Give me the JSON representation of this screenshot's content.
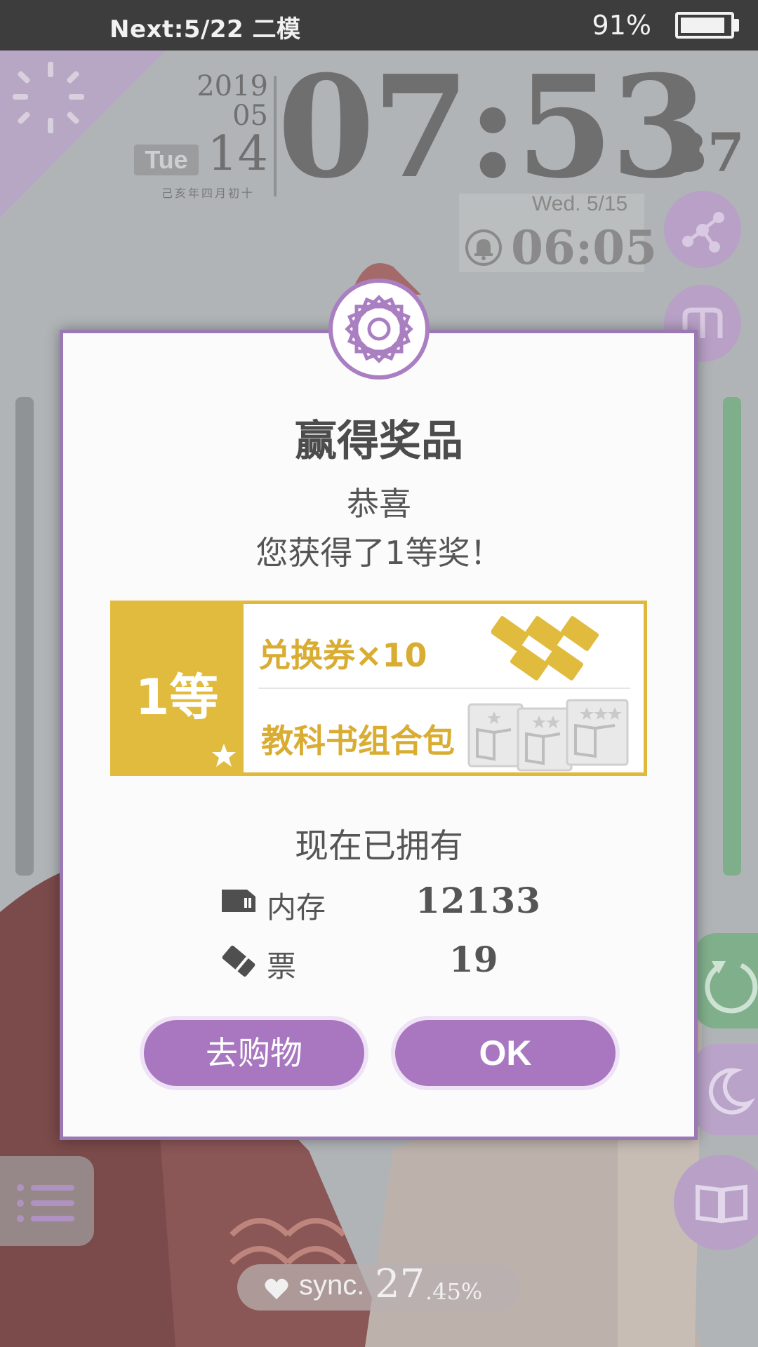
{
  "status_bar": {
    "left_text": "Next:5/22 二模",
    "battery_text": "91%",
    "battery_level": 0.91
  },
  "clock": {
    "year": "2019",
    "month": "05",
    "day": "14",
    "weekday": "Tue",
    "lunar_date": "己亥年四月初十",
    "time": "07:53",
    "seconds": "37"
  },
  "alarm": {
    "date": "Wed.  5/15",
    "time": "06:05"
  },
  "sync": {
    "label": "sync.",
    "value": "27",
    "percent": ".45%"
  },
  "dialog": {
    "title": "赢得奖品",
    "congrats": "恭喜",
    "message": "您获得了1等奖！",
    "prize": {
      "rank": "1等",
      "item1": "兑换券×10",
      "item2": "教科书组合包"
    },
    "owned_title": "现在已拥有",
    "resources": [
      {
        "label": "内存",
        "value": "12133"
      },
      {
        "label": "票",
        "value": "19"
      }
    ],
    "buttons": {
      "shop": "去购物",
      "ok": "OK"
    }
  },
  "colors": {
    "accent_purple": "#a877c0",
    "prize_gold": "#e1bb3d",
    "status_bar": "#3d3d3d"
  },
  "icons": [
    "share-icon",
    "bookmark-icon",
    "refresh-icon",
    "moon-icon",
    "book-icon",
    "menu-icon",
    "heart-icon",
    "bell-icon",
    "memory-card-icon",
    "ticket-icon",
    "star-icon"
  ]
}
